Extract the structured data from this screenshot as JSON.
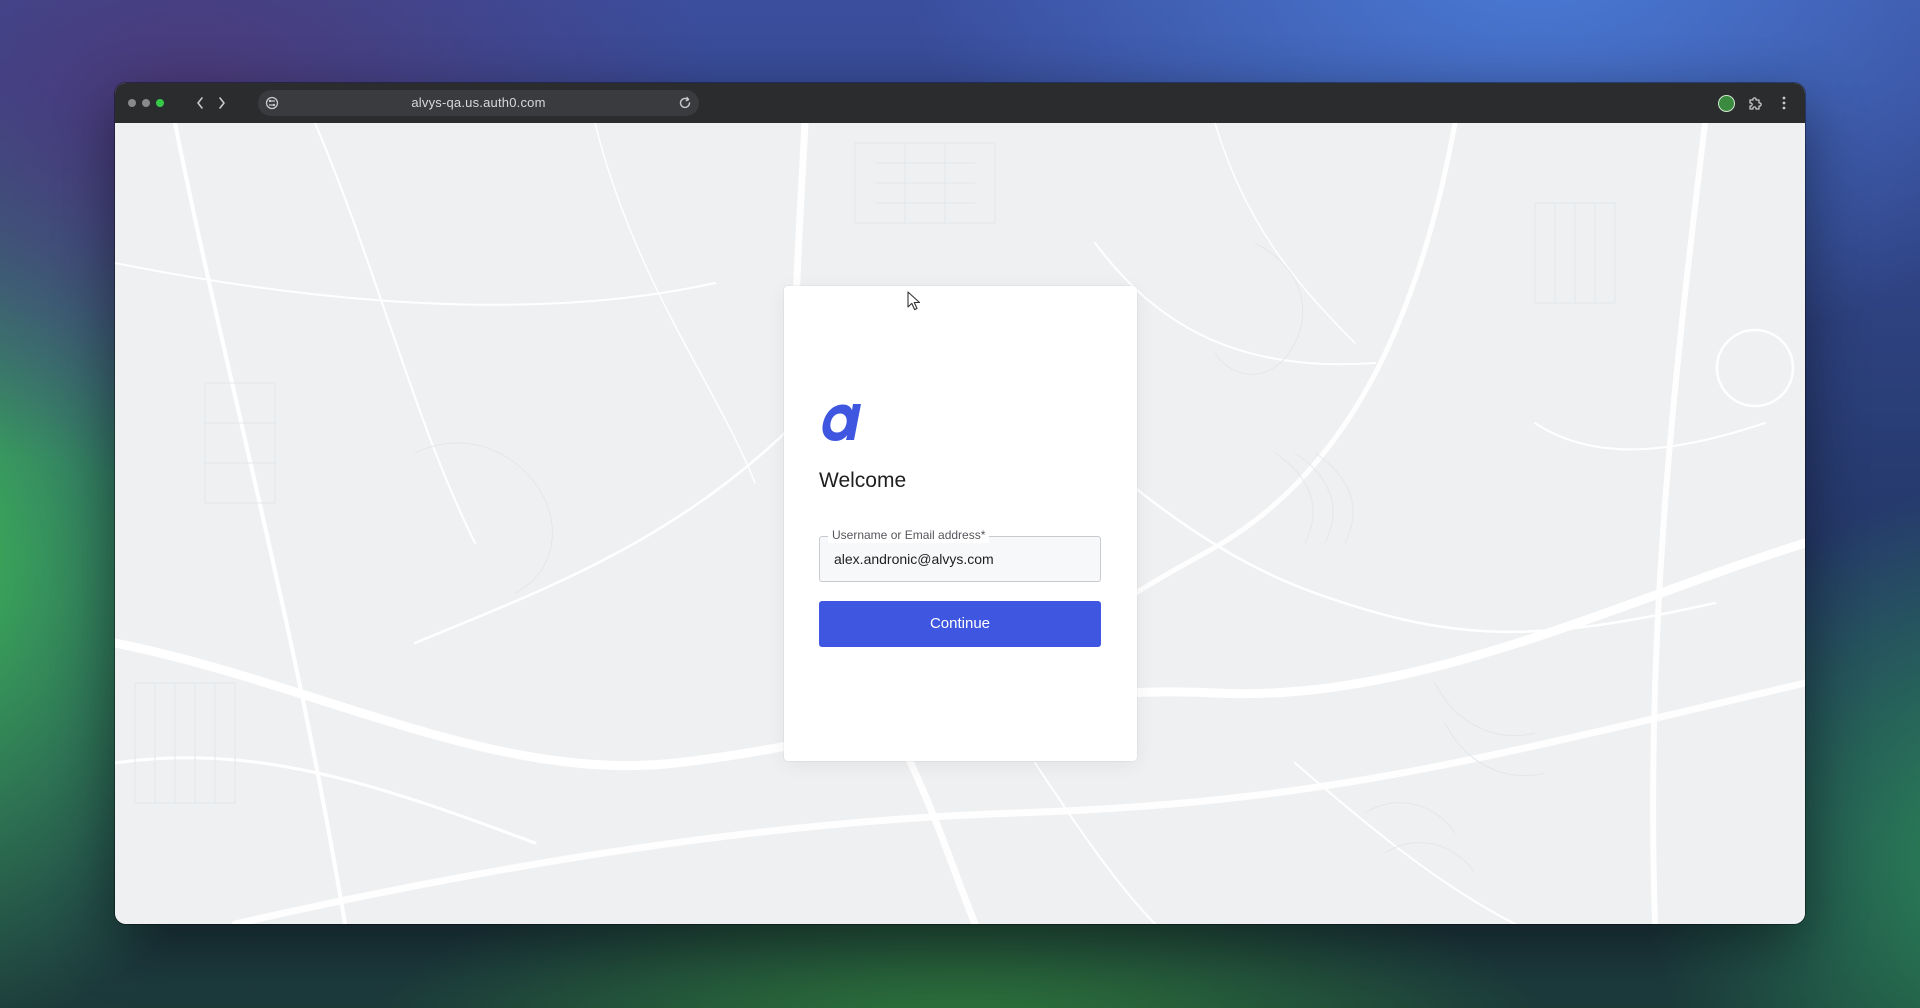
{
  "browser": {
    "url": "alvys-qa.us.auth0.com",
    "icons": [
      "back-arrow-icon",
      "forward-arrow-icon",
      "site-info-icon",
      "reload-icon",
      "profile-icon",
      "extensions-icon",
      "kebab-menu-icon"
    ]
  },
  "login": {
    "logo_letter": "a",
    "welcome": "Welcome",
    "field_label": "Username or Email address*",
    "field_value": "alex.andronic@alvys.com",
    "continue_label": "Continue"
  },
  "colors": {
    "accent": "#3f56e0",
    "logo": "#3f56e0",
    "titlebar": "#2b2c2e"
  }
}
